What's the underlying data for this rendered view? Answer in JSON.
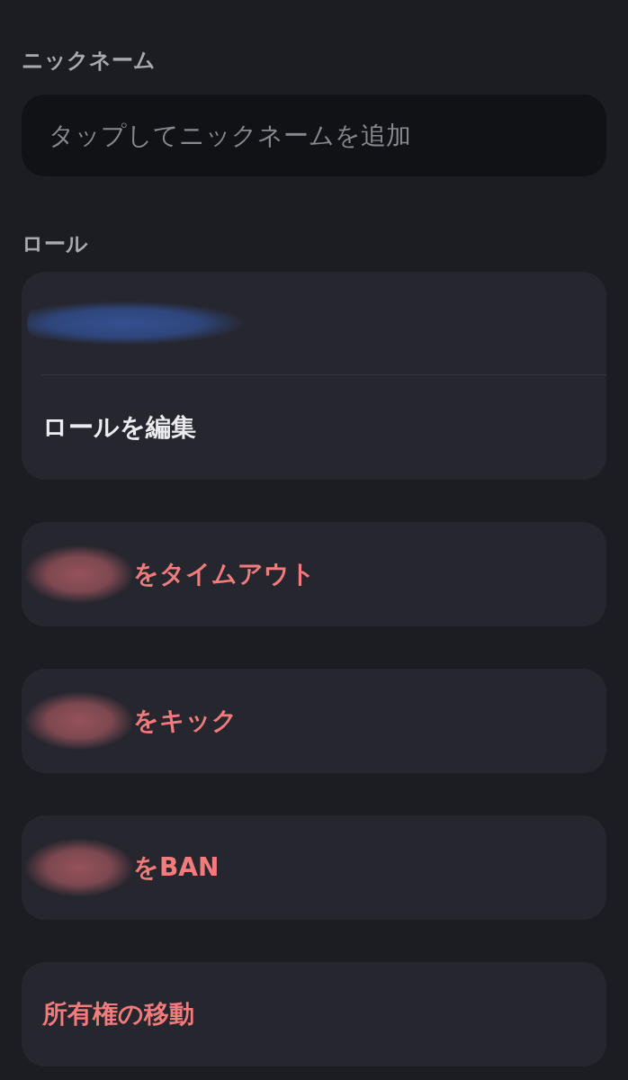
{
  "nickname": {
    "label": "ニックネーム",
    "placeholder": "タップしてニックネームを追加"
  },
  "roles": {
    "label": "ロール",
    "rows": [
      {
        "kind": "redacted"
      },
      {
        "kind": "action",
        "label": "ロールを編集"
      }
    ]
  },
  "actions": [
    {
      "kind": "member",
      "label": "をタイムアウト"
    },
    {
      "kind": "member",
      "label": "をキック"
    },
    {
      "kind": "member",
      "label": "をBAN"
    },
    {
      "kind": "plain",
      "label": "所有権の移動"
    }
  ]
}
